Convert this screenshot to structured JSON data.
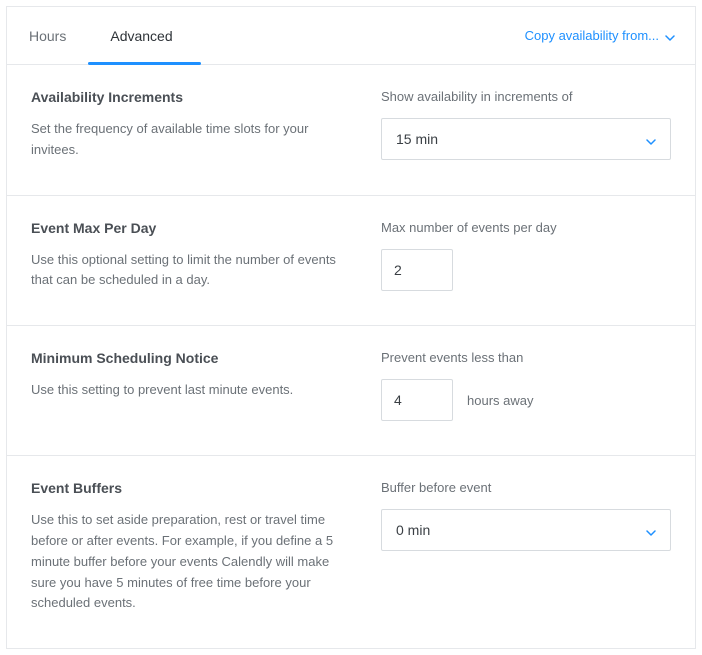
{
  "tabs": {
    "hours": "Hours",
    "advanced": "Advanced"
  },
  "copy_link": "Copy availability from...",
  "sections": {
    "increments": {
      "title": "Availability Increments",
      "desc": "Set the frequency of available time slots for your invitees.",
      "field_label": "Show availability in increments of",
      "value": "15 min"
    },
    "max_per_day": {
      "title": "Event Max Per Day",
      "desc": "Use this optional setting to limit the number of events that can be scheduled in a day.",
      "field_label": "Max number of events per day",
      "value": "2"
    },
    "min_notice": {
      "title": "Minimum Scheduling Notice",
      "desc": "Use this setting to prevent last minute events.",
      "field_label": "Prevent events less than",
      "value": "4",
      "suffix": "hours away"
    },
    "buffers": {
      "title": "Event Buffers",
      "desc": "Use this to set aside preparation, rest or travel time before or after events. For example, if you define a 5 minute buffer before your events Calendly will make sure you have 5 minutes of free time before your scheduled events.",
      "field_label": "Buffer before event",
      "value": "0 min"
    }
  }
}
